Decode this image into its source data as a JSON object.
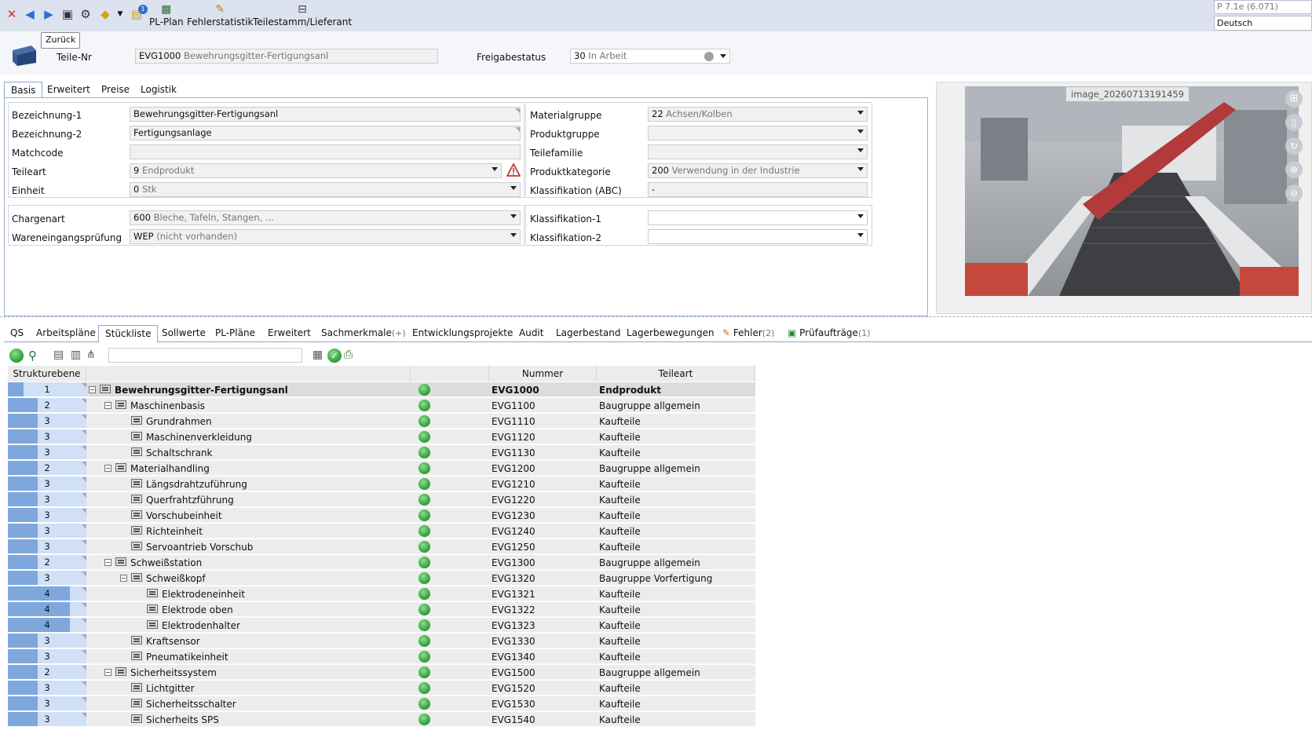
{
  "toolbar": {
    "buttons": [
      {
        "label": "PL-Plan",
        "icon": "pl-plan-icon"
      },
      {
        "label": "Fehlerstatistik",
        "icon": "chart-icon"
      },
      {
        "label": "Teilestamm/Lieferant",
        "icon": "supplier-icon"
      }
    ],
    "badge": "1",
    "version": "P 7.1e (6.071)",
    "language": "Deutsch",
    "tooltip": "Zurück"
  },
  "header": {
    "teile_nr_label": "Teile-Nr",
    "teile_nr_value": "EVG1000",
    "teile_nr_desc": "Bewehrungsgitter-Fertigungsanl",
    "freigabe_label": "Freigabestatus",
    "freigabe_value": "30",
    "freigabe_desc": "In Arbeit"
  },
  "top_tabs": [
    "Basis",
    "Erweitert",
    "Preise",
    "Logistik"
  ],
  "basis": {
    "left": [
      {
        "label": "Bezeichnung-1",
        "value": "Bewehrungsgitter-Fertigungsanl",
        "desc": ""
      },
      {
        "label": "Bezeichnung-2",
        "value": "Fertigungsanlage",
        "desc": ""
      },
      {
        "label": "Matchcode",
        "value": "",
        "desc": ""
      },
      {
        "label": "Teileart",
        "value": "9",
        "desc": "Endprodukt"
      },
      {
        "label": "Einheit",
        "value": "0",
        "desc": "Stk"
      }
    ],
    "left2": [
      {
        "label": "Chargenart",
        "value": "600",
        "desc": "Bleche, Tafeln, Stangen, ..."
      },
      {
        "label": "Wareneingangsprüfung",
        "value": "WEP",
        "desc": "(nicht vorhanden)"
      }
    ],
    "right": [
      {
        "label": "Materialgruppe",
        "value": "22",
        "desc": "Achsen/Kolben"
      },
      {
        "label": "Produktgruppe",
        "value": "",
        "desc": ""
      },
      {
        "label": "Teilefamilie",
        "value": "",
        "desc": ""
      },
      {
        "label": "Produktkategorie",
        "value": "200",
        "desc": "Verwendung in der Industrie"
      },
      {
        "label": "Klassifikation (ABC)",
        "value": "-",
        "desc": ""
      }
    ],
    "right2": [
      {
        "label": "Klassifikation-1",
        "value": "",
        "desc": ""
      },
      {
        "label": "Klassifikation-2",
        "value": "",
        "desc": ""
      }
    ]
  },
  "image": {
    "caption": "image_20260713191459"
  },
  "bottom_tabs": [
    {
      "label": "QS",
      "count": ""
    },
    {
      "label": "Arbeitspläne",
      "count": ""
    },
    {
      "label": "Stückliste",
      "count": ""
    },
    {
      "label": "Sollwerte",
      "count": ""
    },
    {
      "label": "PL-Pläne",
      "count": ""
    },
    {
      "label": "Erweitert",
      "count": ""
    },
    {
      "label": "Sachmerkmale",
      "count": "(+)"
    },
    {
      "label": "Entwicklungsprojekte",
      "count": ""
    },
    {
      "label": "Audit",
      "count": ""
    },
    {
      "label": "Lagerbestand",
      "count": ""
    },
    {
      "label": "Lagerbewegungen",
      "count": ""
    },
    {
      "label": "Fehler",
      "count": "(2)"
    },
    {
      "label": "Prüfaufträge",
      "count": "(1)"
    }
  ],
  "tree": {
    "columns": [
      "Strukturebene",
      "",
      "",
      "Nummer",
      "Teileart"
    ],
    "rows": [
      {
        "level": "1",
        "name": "Bewehrungsgitter-Fertigungsanl",
        "nummer": "EVG1000",
        "teileart": "Endprodukt"
      },
      {
        "level": "2",
        "name": "Maschinenbasis",
        "nummer": "EVG1100",
        "teileart": "Baugruppe allgemein"
      },
      {
        "level": "3",
        "name": "Grundrahmen",
        "nummer": "EVG1110",
        "teileart": "Kaufteile"
      },
      {
        "level": "3",
        "name": "Maschinenverkleidung",
        "nummer": "EVG1120",
        "teileart": "Kaufteile"
      },
      {
        "level": "3",
        "name": "Schaltschrank",
        "nummer": "EVG1130",
        "teileart": "Kaufteile"
      },
      {
        "level": "2",
        "name": "Materialhandling",
        "nummer": "EVG1200",
        "teileart": "Baugruppe allgemein"
      },
      {
        "level": "3",
        "name": "Längsdrahtzuführung",
        "nummer": "EVG1210",
        "teileart": "Kaufteile"
      },
      {
        "level": "3",
        "name": "Querfrahtzführung",
        "nummer": "EVG1220",
        "teileart": "Kaufteile"
      },
      {
        "level": "3",
        "name": "Vorschubeinheit",
        "nummer": "EVG1230",
        "teileart": "Kaufteile"
      },
      {
        "level": "3",
        "name": "Richteinheit",
        "nummer": "EVG1240",
        "teileart": "Kaufteile"
      },
      {
        "level": "3",
        "name": "Servoantrieb Vorschub",
        "nummer": "EVG1250",
        "teileart": "Kaufteile"
      },
      {
        "level": "2",
        "name": "Schweißstation",
        "nummer": "EVG1300",
        "teileart": "Baugruppe allgemein"
      },
      {
        "level": "3",
        "name": "Schweißkopf",
        "nummer": "EVG1320",
        "teileart": "Baugruppe Vorfertigung"
      },
      {
        "level": "4",
        "name": "Elektrodeneinheit",
        "nummer": "EVG1321",
        "teileart": "Kaufteile"
      },
      {
        "level": "4",
        "name": "Elektrode oben",
        "nummer": "EVG1322",
        "teileart": "Kaufteile"
      },
      {
        "level": "4",
        "name": "Elektrodenhalter",
        "nummer": "EVG1323",
        "teileart": "Kaufteile"
      },
      {
        "level": "3",
        "name": "Kraftsensor",
        "nummer": "EVG1330",
        "teileart": "Kaufteile"
      },
      {
        "level": "3",
        "name": "Pneumatikeinheit",
        "nummer": "EVG1340",
        "teileart": "Kaufteile"
      },
      {
        "level": "2",
        "name": "Sicherheitssystem",
        "nummer": "EVG1500",
        "teileart": "Baugruppe allgemein"
      },
      {
        "level": "3",
        "name": "Lichtgitter",
        "nummer": "EVG1520",
        "teileart": "Kaufteile"
      },
      {
        "level": "3",
        "name": "Sicherheitsschalter",
        "nummer": "EVG1530",
        "teileart": "Kaufteile"
      },
      {
        "level": "3",
        "name": "Sicherheits SPS",
        "nummer": "EVG1540",
        "teileart": "Kaufteile"
      }
    ]
  }
}
